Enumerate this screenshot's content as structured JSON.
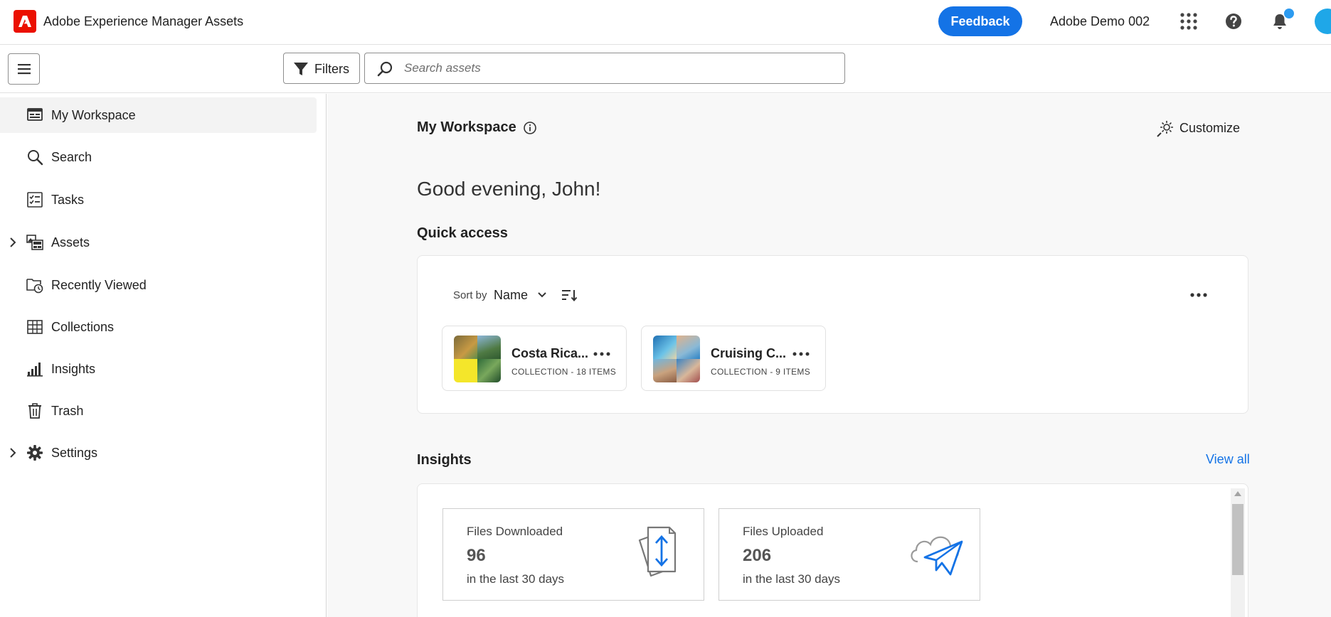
{
  "header": {
    "app_title": "Adobe Experience Manager Assets",
    "feedback_label": "Feedback",
    "org_name": "Adobe Demo 002",
    "icons": [
      "apps-grid-icon",
      "help-icon",
      "bell-icon",
      "avatar"
    ],
    "accent_color": "#1473e6"
  },
  "toolbar": {
    "filters_label": "Filters",
    "search_placeholder": "Search assets",
    "search_value": ""
  },
  "sidebar": {
    "items": [
      {
        "label": "My Workspace",
        "icon": "workspace-icon",
        "active": true,
        "expandable": false
      },
      {
        "label": "Search",
        "icon": "search-icon",
        "active": false,
        "expandable": false
      },
      {
        "label": "Tasks",
        "icon": "tasks-icon",
        "active": false,
        "expandable": false
      },
      {
        "label": "Assets",
        "icon": "assets-icon",
        "active": false,
        "expandable": true
      },
      {
        "label": "Recently Viewed",
        "icon": "recent-folder-icon",
        "active": false,
        "expandable": false
      },
      {
        "label": "Collections",
        "icon": "collections-grid-icon",
        "active": false,
        "expandable": false
      },
      {
        "label": "Insights",
        "icon": "insights-chart-icon",
        "active": false,
        "expandable": false
      },
      {
        "label": "Trash",
        "icon": "trash-icon",
        "active": false,
        "expandable": false
      },
      {
        "label": "Settings",
        "icon": "gear-icon",
        "active": false,
        "expandable": true
      }
    ]
  },
  "main": {
    "title": "My Workspace",
    "customize_label": "Customize",
    "greeting": "Good evening, John!",
    "quick_access": {
      "title": "Quick access",
      "sort_by_label": "Sort by",
      "sort_value": "Name",
      "cards": [
        {
          "name": "Costa Rica...",
          "meta": "COLLECTION - 18 ITEMS"
        },
        {
          "name": "Cruising C...",
          "meta": "COLLECTION - 9 ITEMS"
        }
      ]
    },
    "insights": {
      "title": "Insights",
      "view_all_label": "View all",
      "stats": [
        {
          "title": "Files Downloaded",
          "value": "96",
          "sub": "in the last 30 days",
          "icon": "download-transfer-icon"
        },
        {
          "title": "Files Uploaded",
          "value": "206",
          "sub": "in the last 30 days",
          "icon": "cloud-upload-icon"
        }
      ]
    }
  }
}
